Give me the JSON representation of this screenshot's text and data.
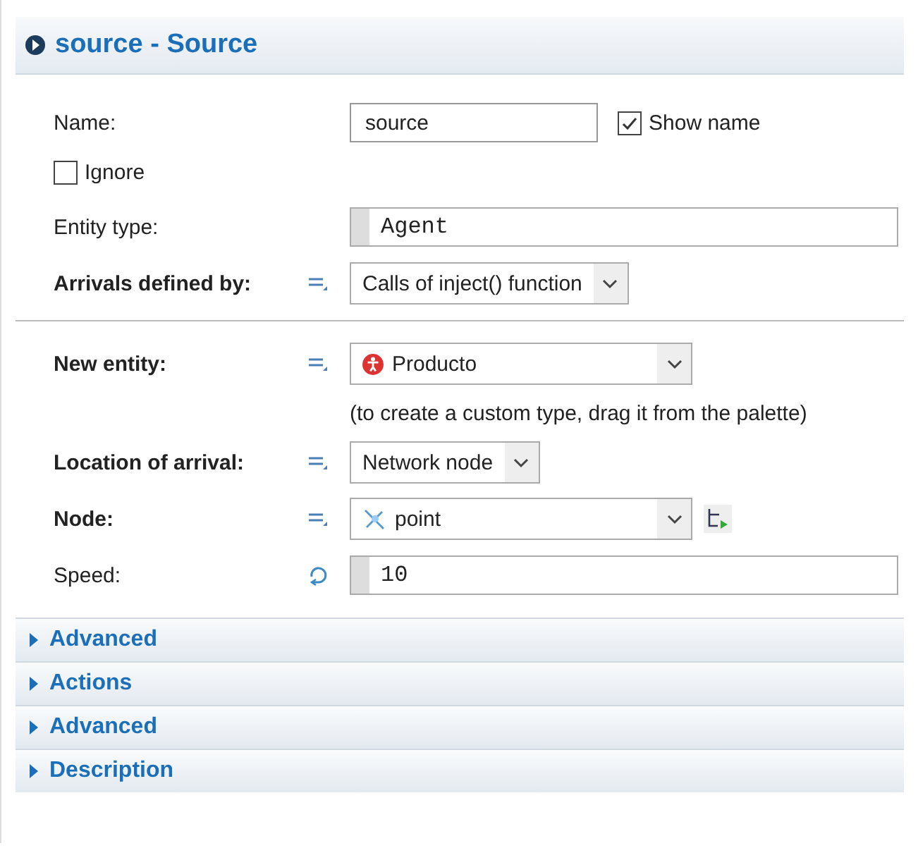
{
  "panel": {
    "title": "source - Source",
    "expanded": true
  },
  "groups": [
    [
      {
        "kind": "text",
        "label": "Name:",
        "bold": false,
        "value": "source",
        "checkbox": {
          "label": "Show name",
          "checked": true
        }
      },
      {
        "kind": "checkbox",
        "label": "Ignore",
        "checked": false
      },
      {
        "kind": "code",
        "label": "Entity type:",
        "bold": false,
        "dynamic": false,
        "value": "Agent"
      },
      {
        "kind": "select",
        "label": "Arrivals defined by:",
        "bold": true,
        "value": "Calls of inject() function"
      }
    ],
    [
      {
        "kind": "agent_select",
        "label": "New entity:",
        "bold": true,
        "value": "Producto",
        "hint": "(to create a custom type, drag it from the palette)"
      },
      {
        "kind": "select",
        "label": "Location of arrival:",
        "bold": true,
        "value": "Network node"
      },
      {
        "kind": "node_select",
        "label": "Node:",
        "bold": true,
        "value": "point",
        "picker": true
      },
      {
        "kind": "code",
        "label": "Speed:",
        "bold": false,
        "dynamic": true,
        "value": "10"
      }
    ]
  ],
  "sections": [
    {
      "label": "Advanced",
      "expanded": false
    },
    {
      "label": "Actions",
      "expanded": false
    },
    {
      "label": "Advanced",
      "expanded": false
    },
    {
      "label": "Description",
      "expanded": false
    }
  ]
}
